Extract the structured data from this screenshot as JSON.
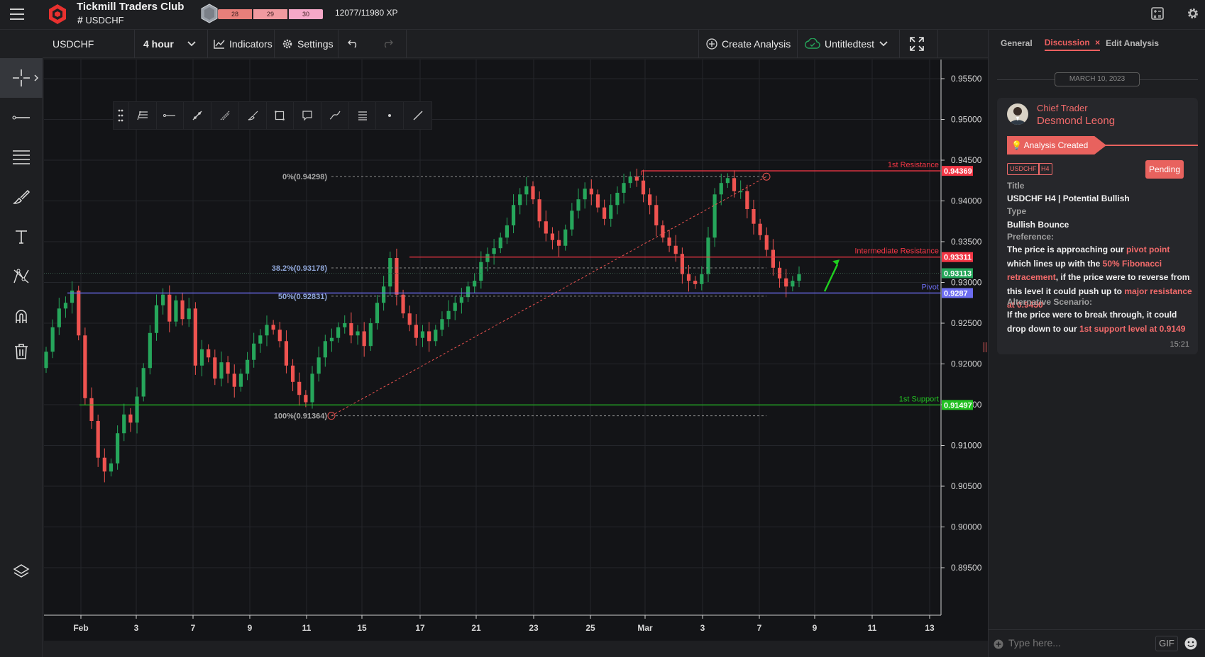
{
  "app": {
    "title": "Tickmill Traders Club",
    "channel": "USDCHF",
    "xp_levels": [
      "28",
      "29",
      "30"
    ],
    "xp_text": "12077/11980 XP"
  },
  "toolbar": {
    "symbol": "USDCHF",
    "interval": "4 hour",
    "indicators": "Indicators",
    "settings": "Settings",
    "create_analysis": "Create Analysis",
    "analysis_name": "Untitledtest"
  },
  "chart": {
    "price_axis_labels": [
      "0.95500",
      "0.95000",
      "0.94500",
      "0.94000",
      "0.93500",
      "0.93000",
      "0.92500",
      "0.92000",
      "0.91500",
      "0.91000",
      "0.90500",
      "0.90000",
      "0.89500"
    ],
    "time_axis_labels": [
      "Feb",
      "3",
      "7",
      "9",
      "11",
      "15",
      "17",
      "21",
      "23",
      "25",
      "Mar",
      "3",
      "7",
      "9",
      "11",
      "13"
    ],
    "fib_levels": [
      {
        "label": "0%(0.94298)",
        "price": 0.94298
      },
      {
        "label": "38.2%(0.93178)",
        "price": 0.93178
      },
      {
        "label": "50%(0.92831)",
        "price": 0.92831
      },
      {
        "label": "100%(0.91364)",
        "price": 0.91364
      }
    ],
    "levels": [
      {
        "name": "1st Resistance",
        "price": 0.94369,
        "price_text": "0.94369",
        "color": "#f23645"
      },
      {
        "name": "Intermediate Resistance",
        "price": 0.93311,
        "price_text": "0.93311",
        "color": "#f23645"
      },
      {
        "name": "Pivot",
        "price": 0.9287,
        "price_text": "0.9287",
        "color": "#6c6cf0"
      },
      {
        "name": "1st Support",
        "price": 0.91497,
        "price_text": "0.91497",
        "color": "#22c022"
      }
    ],
    "current_price": {
      "price": 0.93113,
      "price_text": "0.93113",
      "color": "#26a65b"
    },
    "colors": {
      "up": "#26a65b",
      "down": "#ef5350",
      "bg": "#131417",
      "grid": "#24262b"
    }
  },
  "chart_data": {
    "type": "candlestick",
    "x_ticks": [
      "Feb",
      "3",
      "7",
      "9",
      "11",
      "15",
      "17",
      "21",
      "23",
      "25",
      "Mar",
      "3",
      "7",
      "9",
      "11",
      "13"
    ],
    "y_ticks": [
      0.955,
      0.95,
      0.945,
      0.94,
      0.935,
      0.93,
      0.925,
      0.92,
      0.915,
      0.91,
      0.905,
      0.9,
      0.895
    ],
    "ylim": [
      0.895,
      0.957
    ],
    "key_prices": {
      "resistance_1": 0.94369,
      "intermediate_resistance": 0.93311,
      "pivot": 0.9287,
      "support_1": 0.91497,
      "last": 0.93113
    },
    "fibonacci": [
      {
        "level": "0%",
        "price": 0.94298
      },
      {
        "level": "38.2%",
        "price": 0.93178
      },
      {
        "level": "50%",
        "price": 0.92831
      },
      {
        "level": "100%",
        "price": 0.91364
      }
    ],
    "closes": [
      0.9215,
      0.9245,
      0.9268,
      0.9275,
      0.929,
      0.9235,
      0.9158,
      0.913,
      0.9085,
      0.9068,
      0.9078,
      0.9115,
      0.9138,
      0.9128,
      0.916,
      0.9195,
      0.9238,
      0.9272,
      0.9285,
      0.9252,
      0.9278,
      0.9255,
      0.9268,
      0.9198,
      0.9218,
      0.9208,
      0.9182,
      0.9202,
      0.9188,
      0.9172,
      0.9188,
      0.9205,
      0.9225,
      0.9235,
      0.9248,
      0.9242,
      0.9228,
      0.9198,
      0.9178,
      0.9162,
      0.9153,
      0.9188,
      0.9208,
      0.9228,
      0.9232,
      0.9245,
      0.925,
      0.9235,
      0.924,
      0.9222,
      0.925,
      0.9275,
      0.9295,
      0.933,
      0.9285,
      0.9262,
      0.9248,
      0.9232,
      0.924,
      0.9228,
      0.9242,
      0.9255,
      0.9265,
      0.9275,
      0.9282,
      0.9295,
      0.9302,
      0.9325,
      0.9335,
      0.9342,
      0.9355,
      0.937,
      0.9395,
      0.9408,
      0.9418,
      0.9402,
      0.9375,
      0.936,
      0.9352,
      0.9345,
      0.9365,
      0.9388,
      0.9402,
      0.9415,
      0.9408,
      0.9392,
      0.9378,
      0.9395,
      0.941,
      0.9422,
      0.943,
      0.9425,
      0.9408,
      0.9395,
      0.937,
      0.9355,
      0.9345,
      0.9335,
      0.931,
      0.9302,
      0.9298,
      0.931,
      0.9355,
      0.9408,
      0.9422,
      0.9428,
      0.9412,
      0.9412,
      0.939,
      0.9372,
      0.9358,
      0.934,
      0.9318,
      0.9305,
      0.9295,
      0.9302,
      0.931
    ]
  },
  "panel": {
    "tabs": [
      "General",
      "Discussion",
      "Edit Analysis"
    ],
    "date": "MARCH 10, 2023",
    "role": "Chief Trader",
    "user": "Desmond Leong",
    "ribbon": "Analysis Created",
    "tags": [
      "USDCHF",
      "H4"
    ],
    "status": "Pending",
    "title_label": "Title",
    "title_value": "USDCHF H4 | Potential Bullish",
    "type_label": "Type",
    "type_value": "Bullish Bounce",
    "pref_label": "Preference:",
    "pref_parts": [
      "The price is approaching our ",
      "pivot point",
      " which lines up with the ",
      "50% Fibonacci retracement",
      ", if the price were to reverse from this level it could push up to ",
      "major resistance at 0.9450"
    ],
    "alt_label": "Alternative Scenario:",
    "alt_parts": [
      "If the price were to break through, it could drop down to our ",
      "1st support level at 0.9149"
    ],
    "time": "15:21",
    "composer_placeholder": "Type here...",
    "gif_label": "GIF"
  }
}
